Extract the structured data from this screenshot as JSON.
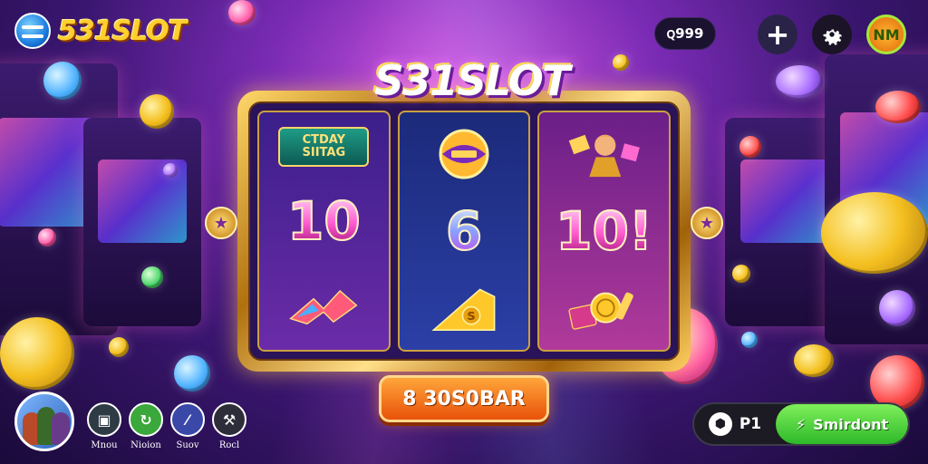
{
  "header": {
    "logo_text": "531SLOT",
    "logo_icon": "menu-lines-icon",
    "balance": "ꞯ999",
    "add_label": "+",
    "avatar_label": "NM"
  },
  "game": {
    "title": "S31SLOT",
    "reels": [
      {
        "top": "CTDAY SIITAG",
        "middle": "10",
        "bottom_icon": "wing-swoosh-icon"
      },
      {
        "top_icon": "crown-ball-icon",
        "middle": "6",
        "bottom_icon": "gold-s-bar-icon"
      },
      {
        "top_icon": "hero-figure-icon",
        "middle": "10!",
        "bottom_icon": "coin-stack-icon"
      }
    ],
    "spin_label": "8 30S0BAR"
  },
  "bottom_menu": [
    {
      "label": "Mnou",
      "icon": "square-icon",
      "color": "#2e3a44"
    },
    {
      "label": "Nioion",
      "icon": "spin-icon",
      "color": "#3aa83a"
    },
    {
      "label": "Suov",
      "icon": "slash-icon",
      "color": "#3a48a8"
    },
    {
      "label": "Rocl",
      "icon": "hammer-icon",
      "color": "#2e2e3a"
    }
  ],
  "bottom_bar": {
    "bet_label": "P1",
    "go_label": "Smirdont"
  },
  "colors": {
    "accent_gold": "#ffcf2e",
    "spin_orange": "#e8520a",
    "go_green": "#2eb82a",
    "bg_purple": "#7a2bb5"
  }
}
